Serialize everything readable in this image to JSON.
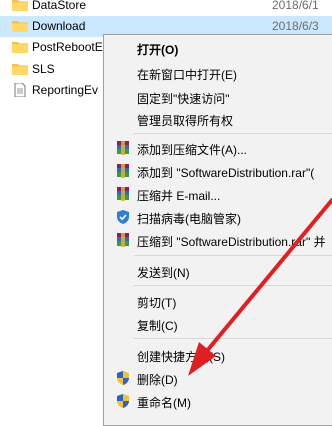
{
  "files": [
    {
      "name": "DataStore",
      "date": "2018/6/1",
      "type": "folder",
      "state": "normal"
    },
    {
      "name": "Download",
      "date": "2018/6/3",
      "type": "folder",
      "state": "selected"
    },
    {
      "name": "PostRebootE",
      "date": "",
      "type": "folder",
      "state": "normal"
    },
    {
      "name": "SLS",
      "date": "",
      "type": "folder",
      "state": "normal"
    },
    {
      "name": "ReportingEv",
      "date": "",
      "type": "file",
      "state": "normal"
    }
  ],
  "menu": {
    "open": "打开(O)",
    "open_new_window": "在新窗口中打开(E)",
    "pin_quick_access": "固定到\"快速访问\"",
    "admin_take_ownership": "管理员取得所有权",
    "add_to_archive": "添加到压缩文件(A)...",
    "add_to_rar": "添加到 \"SoftwareDistribution.rar\"(",
    "compress_email": "压缩并 E-mail...",
    "scan_virus": "扫描病毒(电脑管家)",
    "compress_rar_email": "压缩到 \"SoftwareDistribution.rar\" 并",
    "send_to": "发送到(N)",
    "cut": "剪切(T)",
    "copy": "复制(C)",
    "create_shortcut": "创建快捷方式(S)",
    "delete": "删除(D)",
    "rename": "重命名(M)"
  },
  "colors": {
    "selection": "#cce8ff",
    "menu_bg": "#f2f2f2",
    "folder": "#f5c342",
    "arrow": "#e02020"
  }
}
